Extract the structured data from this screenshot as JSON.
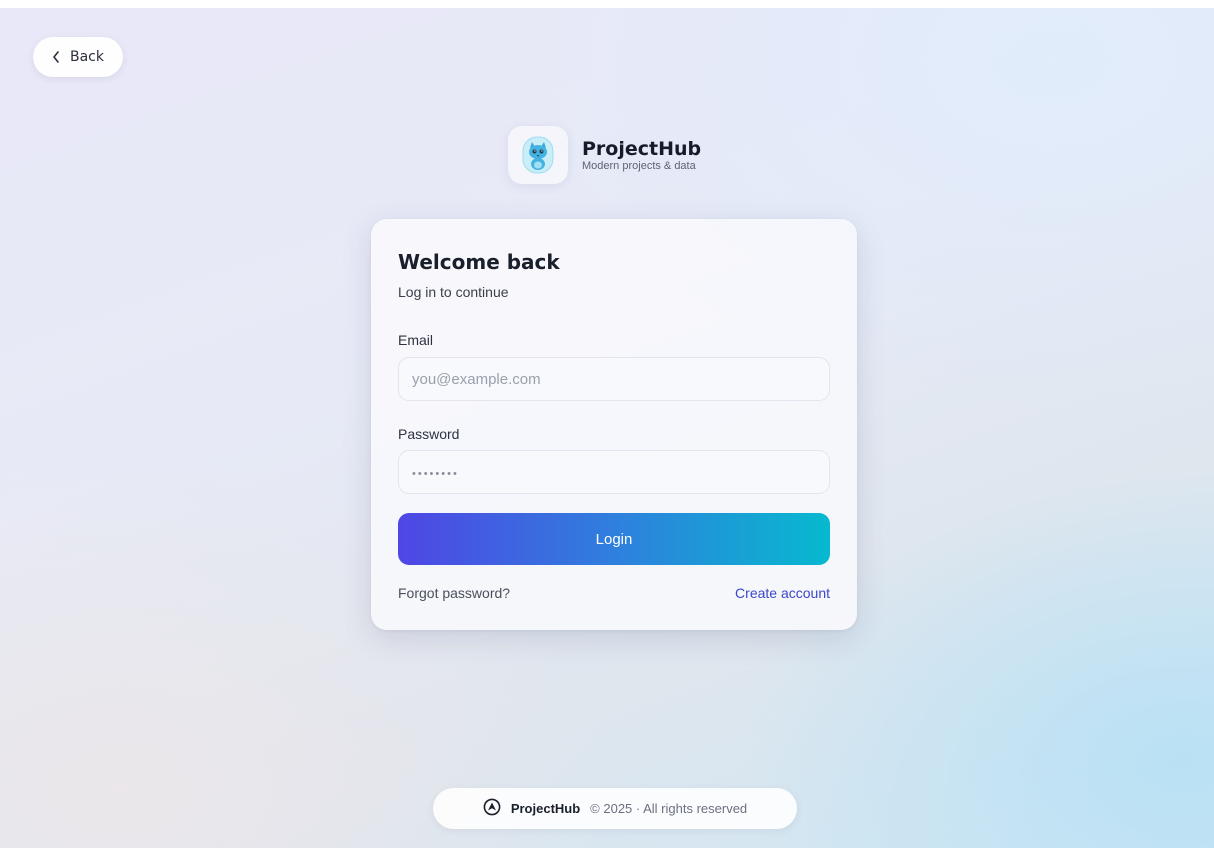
{
  "nav": {
    "back_label": "Back",
    "back_icon": "chevron-left-icon"
  },
  "brand": {
    "name": "ProjectHub",
    "tagline": "Modern projects & data",
    "logo_icon": "cat-mascot-icon"
  },
  "login": {
    "title": "Welcome back",
    "subtitle": "Log in to continue",
    "email_label": "Email",
    "email_placeholder": "you@example.com",
    "email_value": "",
    "password_label": "Password",
    "password_placeholder": "••••••••",
    "password_value": "",
    "submit_label": "Login",
    "forgot_label": "Forgot password?",
    "create_label": "Create account"
  },
  "footer": {
    "brand": "ProjectHub",
    "copyright": "© 2025 · All rights reserved",
    "logo_icon": "projecthub-logo-icon"
  },
  "colors": {
    "accent_start": "#4f46e5",
    "accent_end": "#07b9cf",
    "link": "#3b46c9"
  }
}
